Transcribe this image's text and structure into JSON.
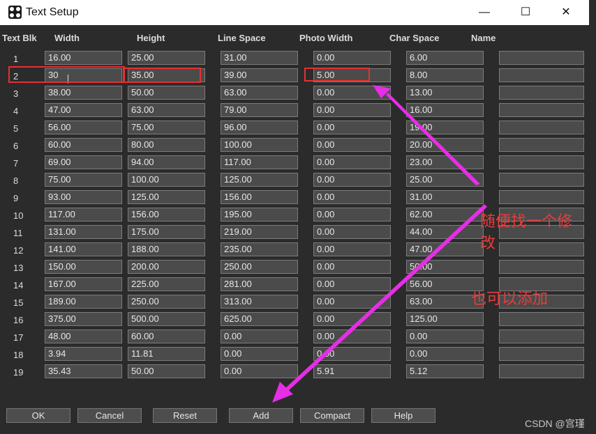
{
  "window": {
    "title": "Text Setup",
    "minimize": "—",
    "maximize": "☐",
    "close": "✕"
  },
  "headers": {
    "blk": "Text Blk",
    "width": "Width",
    "height": "Height",
    "line_space": "Line Space",
    "photo_width": "Photo Width",
    "char_space": "Char Space",
    "name": "Name"
  },
  "rows": [
    {
      "blk": "1",
      "width": "16.00",
      "height": "25.00",
      "line": "31.00",
      "photo": "0.00",
      "char": "6.00",
      "name": ""
    },
    {
      "blk": "2",
      "width": "30",
      "height": "35.00",
      "line": "39.00",
      "photo": "5.00",
      "char": "8.00",
      "name": ""
    },
    {
      "blk": "3",
      "width": "38.00",
      "height": "50.00",
      "line": "63.00",
      "photo": "0.00",
      "char": "13.00",
      "name": ""
    },
    {
      "blk": "4",
      "width": "47.00",
      "height": "63.00",
      "line": "79.00",
      "photo": "0.00",
      "char": "16.00",
      "name": ""
    },
    {
      "blk": "5",
      "width": "56.00",
      "height": "75.00",
      "line": "96.00",
      "photo": "0.00",
      "char": "19.00",
      "name": ""
    },
    {
      "blk": "6",
      "width": "60.00",
      "height": "80.00",
      "line": "100.00",
      "photo": "0.00",
      "char": "20.00",
      "name": ""
    },
    {
      "blk": "7",
      "width": "69.00",
      "height": "94.00",
      "line": "117.00",
      "photo": "0.00",
      "char": "23.00",
      "name": ""
    },
    {
      "blk": "8",
      "width": "75.00",
      "height": "100.00",
      "line": "125.00",
      "photo": "0.00",
      "char": "25.00",
      "name": ""
    },
    {
      "blk": "9",
      "width": "93.00",
      "height": "125.00",
      "line": "156.00",
      "photo": "0.00",
      "char": "31.00",
      "name": ""
    },
    {
      "blk": "10",
      "width": "117.00",
      "height": "156.00",
      "line": "195.00",
      "photo": "0.00",
      "char": "62.00",
      "name": ""
    },
    {
      "blk": "11",
      "width": "131.00",
      "height": "175.00",
      "line": "219.00",
      "photo": "0.00",
      "char": "44.00",
      "name": ""
    },
    {
      "blk": "12",
      "width": "141.00",
      "height": "188.00",
      "line": "235.00",
      "photo": "0.00",
      "char": "47.00",
      "name": ""
    },
    {
      "blk": "13",
      "width": "150.00",
      "height": "200.00",
      "line": "250.00",
      "photo": "0.00",
      "char": "50.00",
      "name": ""
    },
    {
      "blk": "14",
      "width": "167.00",
      "height": "225.00",
      "line": "281.00",
      "photo": "0.00",
      "char": "56.00",
      "name": ""
    },
    {
      "blk": "15",
      "width": "189.00",
      "height": "250.00",
      "line": "313.00",
      "photo": "0.00",
      "char": "63.00",
      "name": ""
    },
    {
      "blk": "16",
      "width": "375.00",
      "height": "500.00",
      "line": "625.00",
      "photo": "0.00",
      "char": "125.00",
      "name": ""
    },
    {
      "blk": "17",
      "width": "48.00",
      "height": "60.00",
      "line": "0.00",
      "photo": "0.00",
      "char": "0.00",
      "name": ""
    },
    {
      "blk": "18",
      "width": "3.94",
      "height": "11.81",
      "line": "0.00",
      "photo": "0.00",
      "char": "0.00",
      "name": ""
    },
    {
      "blk": "19",
      "width": "35.43",
      "height": "50.00",
      "line": "0.00",
      "photo": "5.91",
      "char": "5.12",
      "name": ""
    }
  ],
  "buttons": {
    "ok": "OK",
    "cancel": "Cancel",
    "reset": "Reset",
    "add": "Add",
    "compact": "Compact",
    "help": "Help"
  },
  "annotations": {
    "note_line1": "随便找一个修",
    "note_line2": "改",
    "note_add": "也可以添加"
  },
  "watermark": "CSDN @宫瑾",
  "colors": {
    "background": "#2b2b2b",
    "field": "#4b4b4b",
    "highlight_red": "#e83030",
    "annotation_text": "#e83c3c",
    "arrow_magenta": "#e62ee6"
  }
}
